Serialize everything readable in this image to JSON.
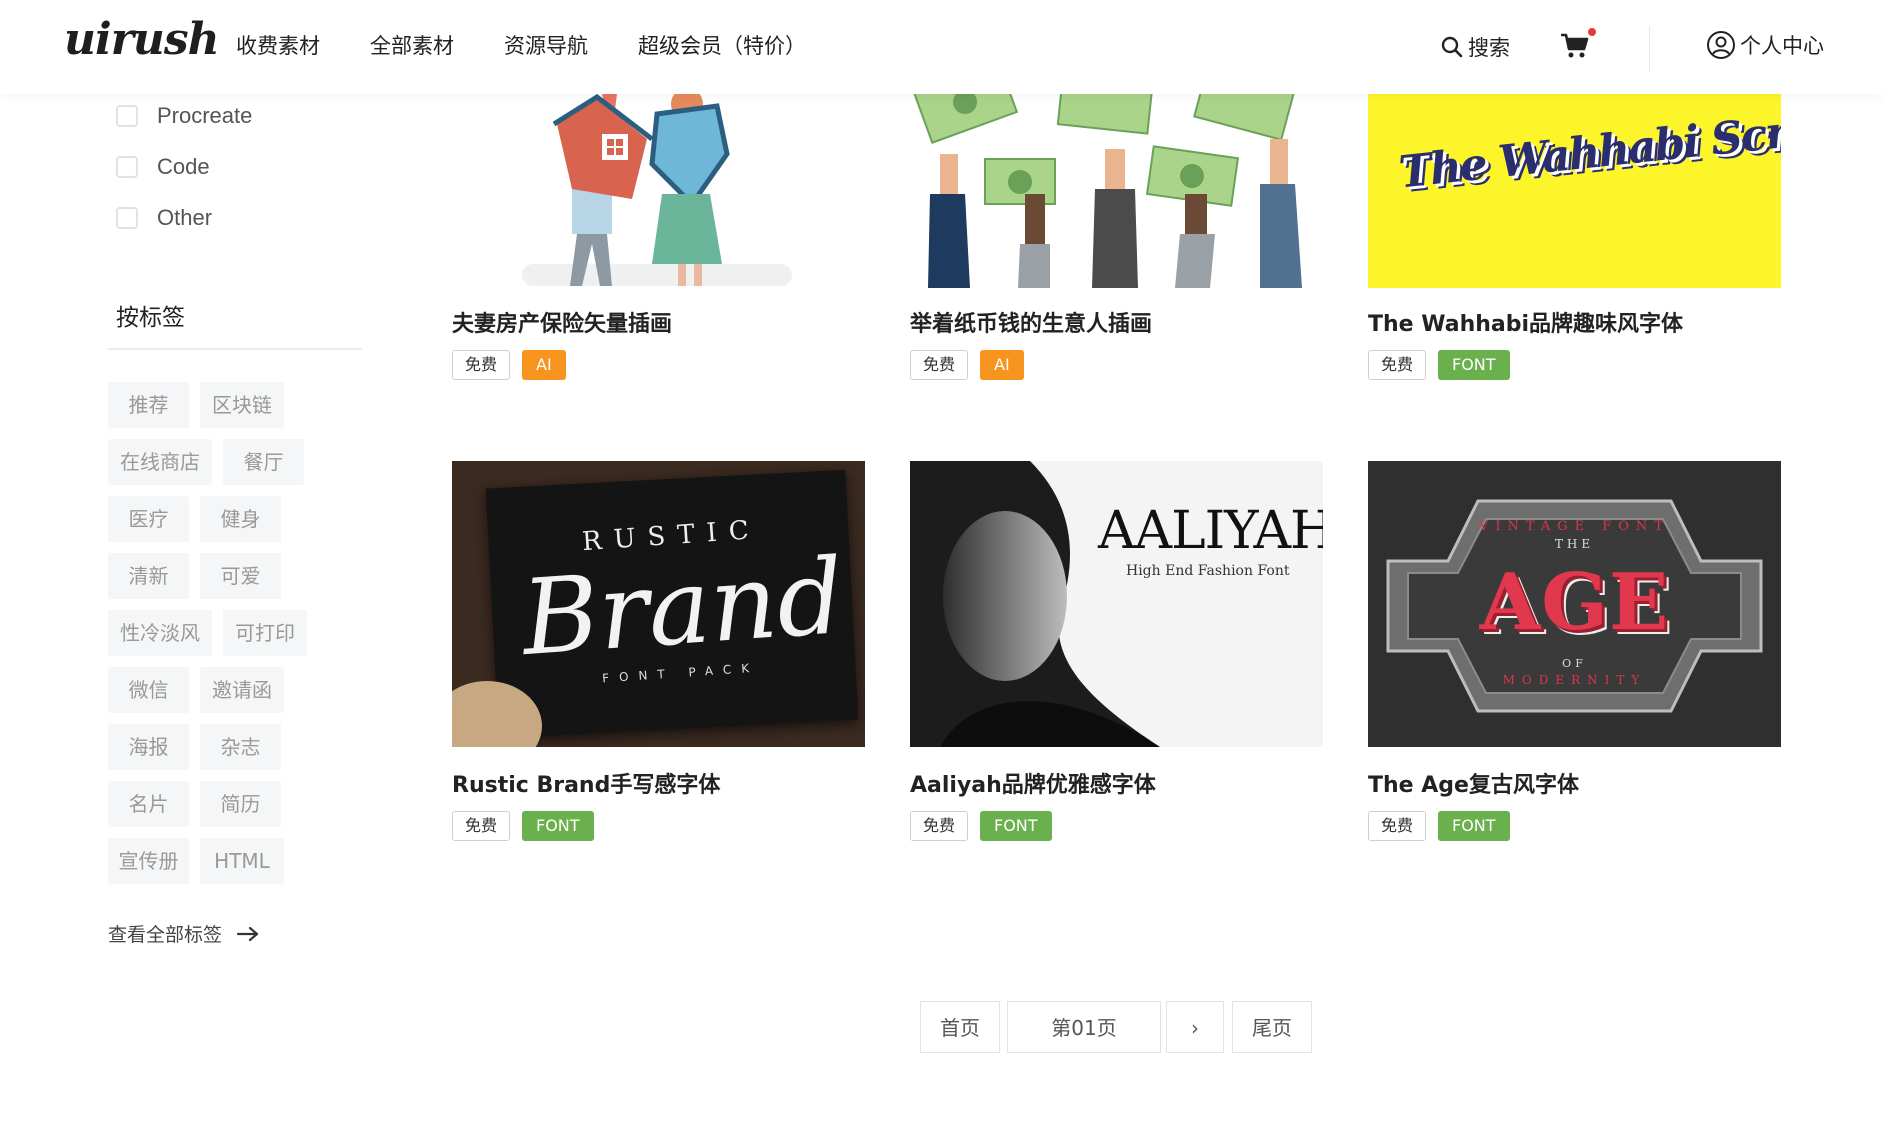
{
  "header": {
    "logo": "uirush",
    "nav": [
      "收费素材",
      "全部素材",
      "资源导航",
      "超级会员（特价）"
    ],
    "search_label": "搜索",
    "user_label": "个人中心"
  },
  "sidebar": {
    "formats": [
      "Procreate",
      "Code",
      "Other"
    ],
    "tags_heading": "按标签",
    "tags": [
      "推荐",
      "区块链",
      "在线商店",
      "餐厅",
      "医疗",
      "健身",
      "清新",
      "可爱",
      "性冷淡风",
      "可打印",
      "微信",
      "邀请函",
      "海报",
      "杂志",
      "名片",
      "简历",
      "宣传册",
      "HTML"
    ],
    "all_tags_label": "查看全部标签"
  },
  "cards": [
    {
      "title": "夫妻房产保险矢量插画",
      "price": "免费",
      "type": "AI",
      "type_color": "#f7941d"
    },
    {
      "title": "举着纸币钱的生意人插画",
      "price": "免费",
      "type": "AI",
      "type_color": "#f7941d"
    },
    {
      "title": "The Wahhabi品牌趣味风字体",
      "price": "免费",
      "type": "FONT",
      "type_color": "#6ab04c",
      "thumb_text": "The Wahhabi Script"
    },
    {
      "title": "Rustic Brand手写感字体",
      "price": "免费",
      "type": "FONT",
      "type_color": "#6ab04c",
      "thumb_text": [
        "RUSTIC",
        "Brand",
        "FONT PACK"
      ]
    },
    {
      "title": "Aaliyah品牌优雅感字体",
      "price": "免费",
      "type": "FONT",
      "type_color": "#6ab04c",
      "thumb_text": [
        "AALIYAH",
        "High End Fashion Font"
      ]
    },
    {
      "title": "The Age复古风字体",
      "price": "免费",
      "type": "FONT",
      "type_color": "#6ab04c",
      "thumb_text": [
        "VINTAGE FONT",
        "THE",
        "AGE",
        "OF",
        "MODERNITY"
      ]
    }
  ],
  "pagination": {
    "first": "首页",
    "current": "第01页",
    "next": "›",
    "last": "尾页"
  },
  "colors": {
    "ai_badge": "#f7941d",
    "font_badge": "#6ab04c",
    "cart_dot": "#e53935",
    "wahhabi_bg": "#fcf52a"
  }
}
